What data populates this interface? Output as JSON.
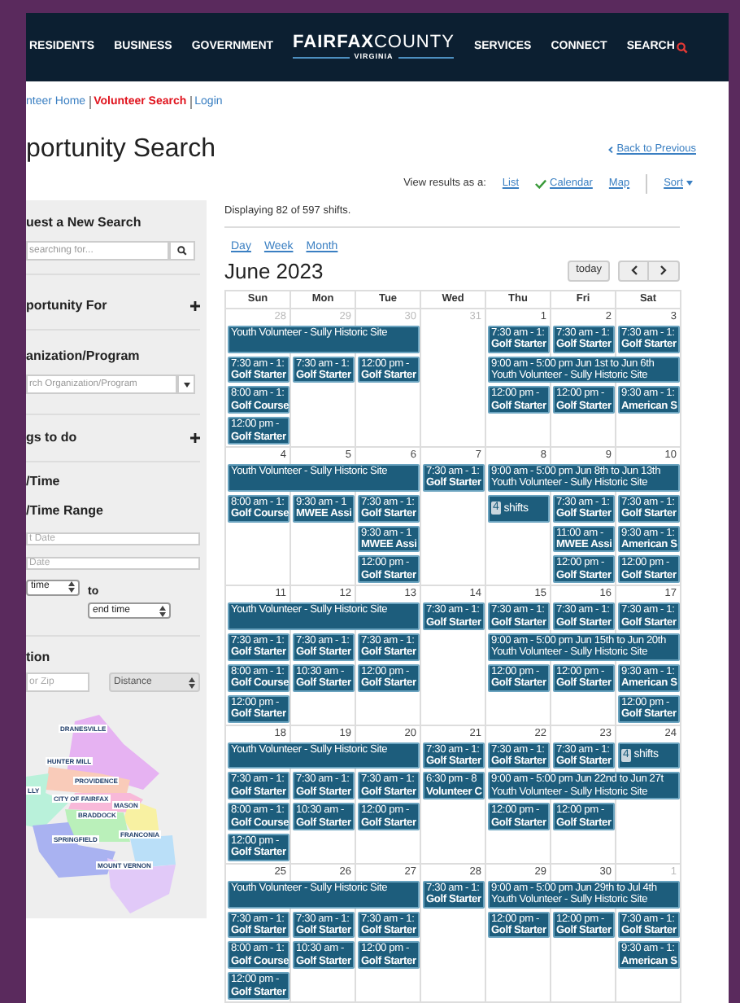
{
  "header": {
    "nav_left": [
      "RESIDENTS",
      "BUSINESS",
      "GOVERNMENT"
    ],
    "logo": {
      "name_bold": "FAIRFAX",
      "name_light": "COUNTY",
      "state": "VIRGINIA"
    },
    "nav_right": [
      "SERVICES",
      "CONNECT"
    ],
    "search": "SEARCH"
  },
  "breadcrumb": [
    {
      "label": "nteer Home",
      "selected": false
    },
    {
      "label": "Volunteer Search",
      "selected": true
    },
    {
      "label": "Login",
      "selected": false
    }
  ],
  "title": "portunity Search",
  "back_link": "Back to Previous",
  "view_as": {
    "label": "View results as a:",
    "options": [
      {
        "label": "List",
        "selected": false
      },
      {
        "label": "Calendar",
        "selected": true
      },
      {
        "label": "Map",
        "selected": false
      }
    ],
    "sort": "Sort"
  },
  "sidebar": {
    "new_search": {
      "heading": "uest a New Search",
      "placeholder": "searching for..."
    },
    "opportunity_for": {
      "heading": "portunity For"
    },
    "organization": {
      "heading": "anization/Program",
      "placeholder": "rch Organization/Program"
    },
    "things_to_do": {
      "heading": "gs to do"
    },
    "date_time": {
      "heading": "/Time",
      "subheading": "/Time Range",
      "start_placeholder": "t Date",
      "end_placeholder": "Date",
      "start_time": "time",
      "joiner": "to",
      "end_time": "end time"
    },
    "location": {
      "heading": "tion",
      "zip_placeholder": "or Zip",
      "distance": "Distance",
      "map_labels": [
        "DRANESVILLE",
        "HUNTER MILL",
        "PROVIDENCE",
        "LLY",
        "CITY OF FAIRFAX",
        "MASON",
        "BRADDOCK",
        "FRANCONIA",
        "SPRINGFIELD",
        "MOUNT VERNON"
      ]
    }
  },
  "results": {
    "count": "Displaying 82 of 597 shifts.",
    "views": [
      "Day",
      "Week",
      "Month"
    ],
    "month": "June 2023",
    "today": "today",
    "weekdays": [
      "Sun",
      "Mon",
      "Tue",
      "Wed",
      "Thu",
      "Fri",
      "Sat"
    ],
    "weeks": [
      {
        "days": [
          {
            "label": "28",
            "other_month": true
          },
          {
            "label": "29",
            "other_month": true
          },
          {
            "label": "30",
            "other_month": true
          },
          {
            "label": "31",
            "other_month": true
          },
          {
            "label": "1",
            "other_month": false
          },
          {
            "label": "2",
            "other_month": false
          },
          {
            "label": "3",
            "other_month": false
          }
        ],
        "lanes": [
          [
            {
              "kind": "span",
              "title": "Youth Volunteer - Sully Historic Site"
            },
            {
              "kind": "empty"
            },
            {
              "kind": "event",
              "time": "7:30 am - 1:",
              "title": "Golf Starter"
            },
            {
              "kind": "event",
              "time": "7:30 am - 1:",
              "title": "Golf Starter"
            },
            {
              "kind": "event",
              "time": "7:30 am - 1:",
              "title": "Golf Starter"
            }
          ],
          [
            {
              "kind": "event",
              "time": "7:30 am - 1:",
              "title": "Golf Starter"
            },
            {
              "kind": "event",
              "time": "7:30 am - 1:",
              "title": "Golf Starter"
            },
            {
              "kind": "event",
              "time": "12:00 pm -",
              "title": "Golf Starter"
            },
            {
              "kind": "empty"
            },
            {
              "kind": "span",
              "time": "9:00 am - 5:00 pm Jun 1st to Jun 6th",
              "title": "Youth Volunteer - Sully Historic Site"
            }
          ],
          [
            {
              "kind": "event",
              "time": "8:00 am - 1:",
              "title": "Golf Course"
            },
            {
              "kind": "empty"
            },
            {
              "kind": "empty"
            },
            {
              "kind": "empty"
            },
            {
              "kind": "event",
              "time": "12:00 pm -",
              "title": "Golf Starter"
            },
            {
              "kind": "event",
              "time": "12:00 pm -",
              "title": "Golf Starter"
            },
            {
              "kind": "event",
              "time": "9:30 am - 1:",
              "title": "American S"
            }
          ],
          [
            {
              "kind": "event",
              "time": "12:00 pm -",
              "title": "Golf Starter"
            }
          ]
        ]
      },
      {
        "days": [
          {
            "label": "4",
            "other_month": false
          },
          {
            "label": "5",
            "other_month": false
          },
          {
            "label": "6",
            "other_month": false
          },
          {
            "label": "7",
            "other_month": false
          },
          {
            "label": "8",
            "other_month": false
          },
          {
            "label": "9",
            "other_month": false
          },
          {
            "label": "10",
            "other_month": false
          }
        ],
        "lanes": [
          [
            {
              "kind": "span",
              "title": "Youth Volunteer - Sully Historic Site"
            },
            {
              "kind": "event",
              "time": "7:30 am - 1:",
              "title": "Golf Starter"
            },
            {
              "kind": "span",
              "time": "9:00 am - 5:00 pm Jun 8th to Jun 13th",
              "title": "Youth Volunteer - Sully Historic Site"
            }
          ],
          [
            {
              "kind": "event",
              "time": "8:00 am - 1:",
              "title": "Golf Course"
            },
            {
              "kind": "event",
              "time": "9:30 am - 1",
              "title": "MWEE Assi"
            },
            {
              "kind": "event",
              "time": "7:30 am - 1:",
              "title": "Golf Starter"
            },
            {
              "kind": "empty"
            },
            {
              "kind": "more",
              "count": "4",
              "label": "shifts"
            },
            {
              "kind": "event",
              "time": "7:30 am - 1:",
              "title": "Golf Starter"
            },
            {
              "kind": "event",
              "time": "7:30 am - 1:",
              "title": "Golf Starter"
            }
          ],
          [
            {
              "kind": "empty"
            },
            {
              "kind": "empty"
            },
            {
              "kind": "event",
              "time": "9:30 am - 1",
              "title": "MWEE Assi"
            },
            {
              "kind": "empty"
            },
            {
              "kind": "empty"
            },
            {
              "kind": "event",
              "time": "11:00 am -",
              "title": "MWEE Assi"
            },
            {
              "kind": "event",
              "time": "9:30 am - 1:",
              "title": "American S"
            }
          ],
          [
            {
              "kind": "empty"
            },
            {
              "kind": "empty"
            },
            {
              "kind": "event",
              "time": "12:00 pm -",
              "title": "Golf Starter"
            },
            {
              "kind": "empty"
            },
            {
              "kind": "empty"
            },
            {
              "kind": "event",
              "time": "12:00 pm -",
              "title": "Golf Starter"
            },
            {
              "kind": "event",
              "time": "12:00 pm -",
              "title": "Golf Starter"
            }
          ]
        ]
      },
      {
        "days": [
          {
            "label": "11",
            "other_month": false
          },
          {
            "label": "12",
            "other_month": false
          },
          {
            "label": "13",
            "other_month": false
          },
          {
            "label": "14",
            "other_month": false
          },
          {
            "label": "15",
            "other_month": false
          },
          {
            "label": "16",
            "other_month": false
          },
          {
            "label": "17",
            "other_month": false
          }
        ],
        "lanes": [
          [
            {
              "kind": "span",
              "title": "Youth Volunteer - Sully Historic Site"
            },
            {
              "kind": "event",
              "time": "7:30 am - 1:",
              "title": "Golf Starter"
            },
            {
              "kind": "event",
              "time": "7:30 am - 1:",
              "title": "Golf Starter"
            },
            {
              "kind": "event",
              "time": "7:30 am - 1:",
              "title": "Golf Starter"
            },
            {
              "kind": "event",
              "time": "7:30 am - 1:",
              "title": "Golf Starter"
            }
          ],
          [
            {
              "kind": "event",
              "time": "7:30 am - 1:",
              "title": "Golf Starter"
            },
            {
              "kind": "event",
              "time": "7:30 am - 1:",
              "title": "Golf Starter"
            },
            {
              "kind": "event",
              "time": "7:30 am - 1:",
              "title": "Golf Starter"
            },
            {
              "kind": "empty"
            },
            {
              "kind": "span",
              "time": "9:00 am - 5:00 pm Jun 15th to Jun 20th",
              "title": "Youth Volunteer - Sully Historic Site"
            }
          ],
          [
            {
              "kind": "event",
              "time": "8:00 am - 1:",
              "title": "Golf Course"
            },
            {
              "kind": "event",
              "time": "10:30 am -",
              "title": "Golf Starter"
            },
            {
              "kind": "event",
              "time": "12:00 pm -",
              "title": "Golf Starter"
            },
            {
              "kind": "empty"
            },
            {
              "kind": "event",
              "time": "12:00 pm -",
              "title": "Golf Starter"
            },
            {
              "kind": "event",
              "time": "12:00 pm -",
              "title": "Golf Starter"
            },
            {
              "kind": "event",
              "time": "9:30 am - 1:",
              "title": "American S"
            }
          ],
          [
            {
              "kind": "event",
              "time": "12:00 pm -",
              "title": "Golf Starter"
            },
            {
              "kind": "empty"
            },
            {
              "kind": "empty"
            },
            {
              "kind": "empty"
            },
            {
              "kind": "empty"
            },
            {
              "kind": "empty"
            },
            {
              "kind": "event",
              "time": "12:00 pm -",
              "title": "Golf Starter"
            }
          ]
        ]
      },
      {
        "days": [
          {
            "label": "18",
            "other_month": false
          },
          {
            "label": "19",
            "other_month": false
          },
          {
            "label": "20",
            "other_month": false
          },
          {
            "label": "21",
            "other_month": false
          },
          {
            "label": "22",
            "other_month": false
          },
          {
            "label": "23",
            "other_month": false
          },
          {
            "label": "24",
            "other_month": false
          }
        ],
        "lanes": [
          [
            {
              "kind": "span",
              "title": "Youth Volunteer - Sully Historic Site"
            },
            {
              "kind": "event",
              "time": "7:30 am - 1:",
              "title": "Golf Starter"
            },
            {
              "kind": "event",
              "time": "7:30 am - 1:",
              "title": "Golf Starter"
            },
            {
              "kind": "event",
              "time": "7:30 am - 1:",
              "title": "Golf Starter"
            },
            {
              "kind": "more",
              "count": "4",
              "label": "shifts"
            }
          ],
          [
            {
              "kind": "event",
              "time": "7:30 am - 1:",
              "title": "Golf Starter"
            },
            {
              "kind": "event",
              "time": "7:30 am - 1:",
              "title": "Golf Starter"
            },
            {
              "kind": "event",
              "time": "7:30 am - 1:",
              "title": "Golf Starter"
            },
            {
              "kind": "event",
              "time": "6:30 pm - 8",
              "title": "Volunteer C"
            },
            {
              "kind": "span",
              "time": "9:00 am - 5:00 pm Jun 22nd to Jun 27t",
              "title": "Youth Volunteer - Sully Historic Site"
            }
          ],
          [
            {
              "kind": "event",
              "time": "8:00 am - 1:",
              "title": "Golf Course"
            },
            {
              "kind": "event",
              "time": "10:30 am -",
              "title": "Golf Starter"
            },
            {
              "kind": "event",
              "time": "12:00 pm -",
              "title": "Golf Starter"
            },
            {
              "kind": "empty"
            },
            {
              "kind": "event",
              "time": "12:00 pm -",
              "title": "Golf Starter"
            },
            {
              "kind": "event",
              "time": "12:00 pm -",
              "title": "Golf Starter"
            }
          ],
          [
            {
              "kind": "event",
              "time": "12:00 pm -",
              "title": "Golf Starter"
            }
          ]
        ]
      },
      {
        "days": [
          {
            "label": "25",
            "other_month": false
          },
          {
            "label": "26",
            "other_month": false
          },
          {
            "label": "27",
            "other_month": false
          },
          {
            "label": "28",
            "other_month": false
          },
          {
            "label": "29",
            "other_month": false
          },
          {
            "label": "30",
            "other_month": false
          },
          {
            "label": "1",
            "other_month": true
          }
        ],
        "lanes": [
          [
            {
              "kind": "span",
              "title": "Youth Volunteer - Sully Historic Site"
            },
            {
              "kind": "event",
              "time": "7:30 am - 1:",
              "title": "Golf Starter"
            },
            {
              "kind": "span",
              "time": "9:00 am - 5:00 pm Jun 29th to Jul 4th",
              "title": "Youth Volunteer - Sully Historic Site"
            }
          ],
          [
            {
              "kind": "event",
              "time": "7:30 am - 1:",
              "title": "Golf Starter"
            },
            {
              "kind": "event",
              "time": "7:30 am - 1:",
              "title": "Golf Starter"
            },
            {
              "kind": "event",
              "time": "7:30 am - 1:",
              "title": "Golf Starter"
            },
            {
              "kind": "empty"
            },
            {
              "kind": "event",
              "time": "12:00 pm -",
              "title": "Golf Starter"
            },
            {
              "kind": "event",
              "time": "12:00 pm -",
              "title": "Golf Starter"
            },
            {
              "kind": "event",
              "time": "7:30 am - 1:",
              "title": "Golf Starter"
            }
          ],
          [
            {
              "kind": "event",
              "time": "8:00 am - 1:",
              "title": "Golf Course"
            },
            {
              "kind": "event",
              "time": "10:30 am -",
              "title": "Golf Starter"
            },
            {
              "kind": "event",
              "time": "12:00 pm -",
              "title": "Golf Starter"
            },
            {
              "kind": "empty"
            },
            {
              "kind": "empty"
            },
            {
              "kind": "empty"
            },
            {
              "kind": "event",
              "time": "9:30 am - 1:",
              "title": "American S"
            }
          ],
          [
            {
              "kind": "event",
              "time": "12:00 pm -",
              "title": "Golf Starter"
            }
          ]
        ]
      }
    ]
  }
}
